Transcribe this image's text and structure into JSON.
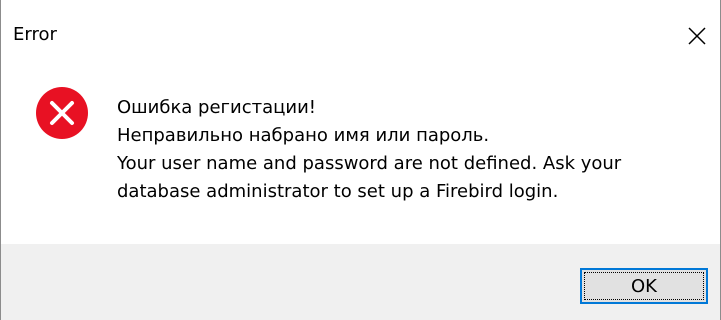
{
  "window": {
    "title": "Error",
    "close_icon": "close-icon"
  },
  "message": {
    "icon": "error-icon",
    "lines": [
      "Ошибка регистации!",
      "Неправильно набрано имя или пароль.",
      "Your user name and password are not defined. Ask your",
      "database administrator to set up a Firebird login."
    ]
  },
  "buttons": {
    "ok_label": "OK"
  },
  "colors": {
    "error_red": "#e81123",
    "focus_blue": "#0078d7",
    "footer_bg": "#f0f0f0",
    "button_bg": "#e1e1e1"
  }
}
